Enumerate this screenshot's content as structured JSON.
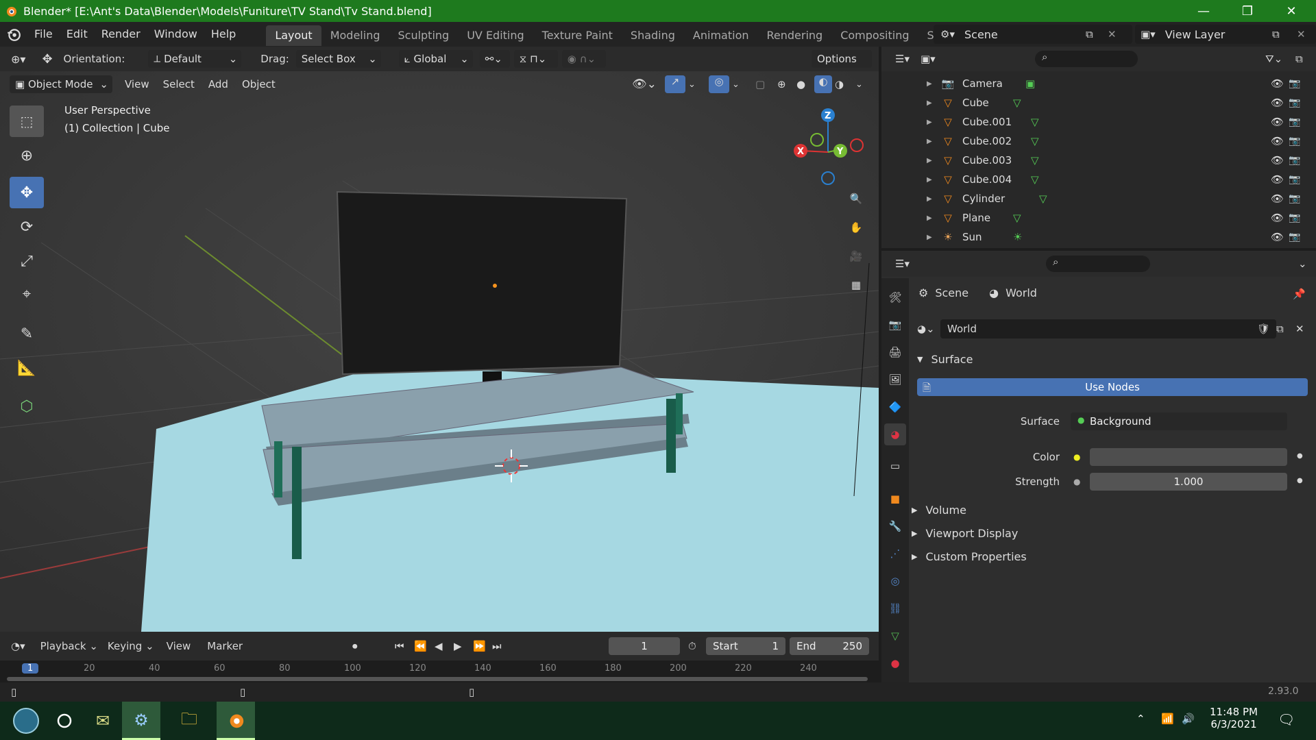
{
  "window": {
    "title": "Blender* [E:\\Ant's Data\\Blender\\Models\\Funiture\\TV Stand\\Tv Stand.blend]",
    "minimize": "—",
    "maximize": "❐",
    "close": "✕"
  },
  "menu": {
    "items": [
      "File",
      "Edit",
      "Render",
      "Window",
      "Help"
    ]
  },
  "workspaces": {
    "tabs": [
      "Layout",
      "Modeling",
      "Sculpting",
      "UV Editing",
      "Texture Paint",
      "Shading",
      "Animation",
      "Rendering",
      "Compositing",
      "Scripting"
    ],
    "active": "Layout",
    "add": "+"
  },
  "scene": {
    "label": "Scene",
    "view_layer": "View Layer"
  },
  "header": {
    "orientation_label": "Orientation:",
    "orientation_value": "Default",
    "drag_label": "Drag:",
    "drag_value": "Select Box",
    "transform": "Global",
    "options": "Options"
  },
  "header2": {
    "mode": "Object Mode",
    "items": [
      "View",
      "Select",
      "Add",
      "Object"
    ]
  },
  "viewport": {
    "perspective": "User Perspective",
    "collection": "(1) Collection | Cube"
  },
  "gizmo": {
    "x": "X",
    "y": "Y",
    "z": "Z"
  },
  "outliner": {
    "items": [
      {
        "name": "Camera",
        "type": "camera"
      },
      {
        "name": "Cube",
        "type": "mesh"
      },
      {
        "name": "Cube.001",
        "type": "mesh"
      },
      {
        "name": "Cube.002",
        "type": "mesh"
      },
      {
        "name": "Cube.003",
        "type": "mesh"
      },
      {
        "name": "Cube.004",
        "type": "mesh"
      },
      {
        "name": "Cylinder",
        "type": "mesh"
      },
      {
        "name": "Plane",
        "type": "mesh"
      },
      {
        "name": "Sun",
        "type": "light"
      }
    ]
  },
  "properties": {
    "breadcrumb_scene": "Scene",
    "breadcrumb_world": "World",
    "world_name": "World",
    "surface_panel": "Surface",
    "use_nodes": "Use Nodes",
    "surface_label": "Surface",
    "surface_value": "Background",
    "color_label": "Color",
    "strength_label": "Strength",
    "strength_value": "1.000",
    "volume_panel": "Volume",
    "viewport_display_panel": "Viewport Display",
    "custom_props_panel": "Custom Properties"
  },
  "timeline": {
    "playback": "Playback",
    "keying": "Keying",
    "view": "View",
    "marker": "Marker",
    "current_frame": "1",
    "start_label": "Start",
    "start_value": "1",
    "end_label": "End",
    "end_value": "250",
    "ruler": [
      "1",
      "20",
      "40",
      "60",
      "80",
      "100",
      "120",
      "140",
      "160",
      "180",
      "200",
      "220",
      "240"
    ]
  },
  "status": {
    "version": "2.93.0"
  },
  "taskbar": {
    "time": "11:48 PM",
    "date": "6/3/2021"
  },
  "colors": {
    "accent": "#4772b3",
    "title": "#1e7a1e",
    "floor": "#a6d8e2"
  }
}
